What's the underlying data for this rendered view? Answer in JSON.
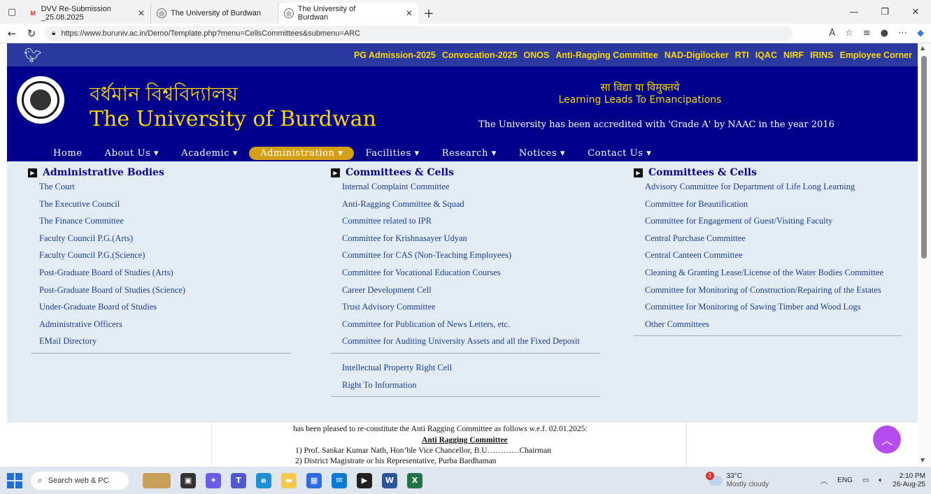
{
  "browser": {
    "tabs": [
      {
        "label": "DVV Re-Submission _25.08.2025",
        "favicon": "gmail-icon"
      },
      {
        "label": "The University of Burdwan",
        "favicon": "seal-icon"
      },
      {
        "label": "The University of Burdwan",
        "favicon": "seal-icon"
      }
    ],
    "url": "https://www.buruniv.ac.in/Demo/Template.php?menu=CellsCommittees&submenu=ARC"
  },
  "site": {
    "top_links": [
      "PG Admission-2025",
      "Convocation-2025",
      "ONOS",
      "Anti-Ragging Committee",
      "NAD-Digilocker",
      "RTI",
      "IQAC",
      "NIRF",
      "IRINS",
      "Employee Corner"
    ],
    "name_bengali": "বর্ধমান বিশ্ববিদ্যালয়",
    "name_english": "The University of Burdwan",
    "motto_hindi": "सा विद्या या विमुक्तये",
    "motto_english": "Learning Leads To Emancipations",
    "accreditation": "The University has been accredited with 'Grade A' by NAAC in the year 2016",
    "nav": [
      "Home",
      "About Us ▾",
      "Academic ▾",
      "Administration ▾",
      "Facilities ▾",
      "Research ▾",
      "Notices ▾",
      "Contact Us ▾"
    ],
    "accent_color": "#d4a017",
    "header_color": "#00008b"
  },
  "mega": {
    "col1": {
      "title": "Administrative Bodies",
      "items": [
        "The Court",
        "The Executive Council",
        "The Finance Committee",
        "Faculty Council P.G.(Arts)",
        "Faculty Council P.G.(Science)",
        "Post-Graduate Board of Studies (Arts)",
        "Post-Graduate Board of Studies (Science)",
        "Under-Graduate Board of Studies",
        "Administrative Officers",
        "EMail Directory"
      ]
    },
    "col2": {
      "title": "Committees & Cells",
      "items": [
        "Internal Complaint Committee",
        "Anti-Ragging Committee & Squad",
        "Committee related to IPR",
        "Committee for Krishnasayer Udyan",
        "Committee for CAS (Non-Teaching Employees)",
        "Committee for Vocational Education Courses",
        "Career Development Cell",
        "Trust Advisory Committee",
        "Committee for Publication of News Letters, etc.",
        "Committee for Auditing University Assets and all the Fixed Deposit"
      ],
      "extra_items": [
        "Intellectual Property Right Cell",
        "Right To Information"
      ]
    },
    "col3": {
      "title": "Committees & Cells",
      "items": [
        "Advisory Committee for Department of Life Long Learning",
        "Committee for Beautification",
        "Committee for Engagement of Guest/Visiting Faculty",
        "Central Purchase Committee",
        "Central Canteen Committee",
        "Cleaning & Granting Lease/License of the Water Bodies Committee",
        "Committee for Monitoring of Construction/Repairing of the Estates",
        "Committee for Monitoring of Sawing Timber and Wood Logs",
        "Other Committees"
      ]
    }
  },
  "document": {
    "line1": "has been pleased to re-constitute the Anti Ragging Committee as follows w.e.f. 02.01.2025:",
    "heading": "Anti Ragging Committee",
    "line3": "1)  Prof. Sankar Kumar Nath, Hon’ble Vice Chancellor, B.U…………Chairman",
    "line4": "2)  District Magistrate or his Representative, Purba Bardhaman"
  },
  "taskbar": {
    "search_placeholder": "Search web & PC",
    "weather_temp": "33°C",
    "weather_desc": "Mostly cloudy",
    "weather_badge": "3",
    "lang": "ENG",
    "time": "2:10 PM",
    "date": "26-Aug-25"
  }
}
